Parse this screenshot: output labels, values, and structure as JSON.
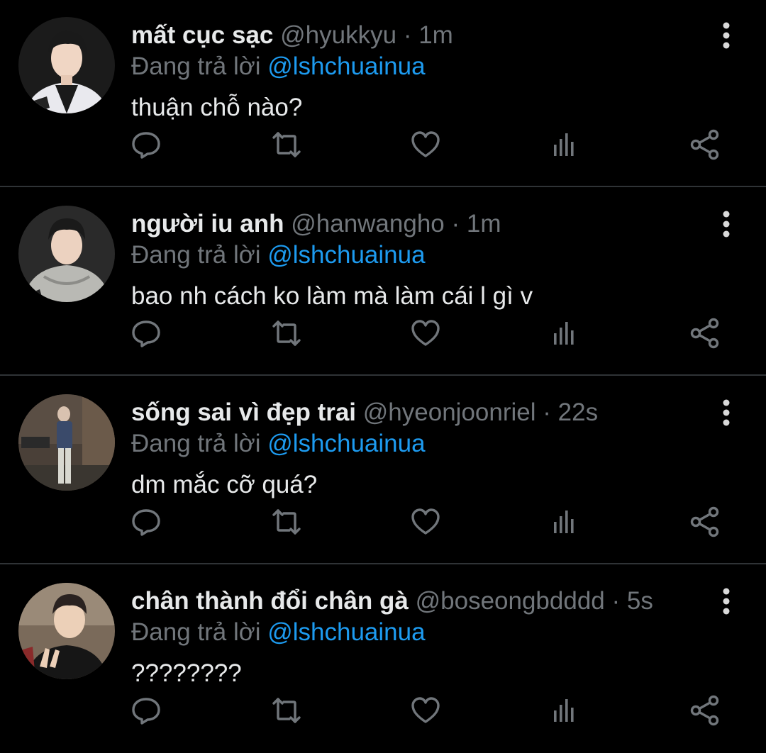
{
  "reply_prefix": "Đang trả lời",
  "colors": {
    "background": "#000000",
    "name": "#e7e9ea",
    "secondary": "#71767b",
    "mention": "#1d9bf0",
    "divider": "#2f3336"
  },
  "action_icons": [
    "reply-icon",
    "retweet-icon",
    "like-icon",
    "views-icon",
    "share-icon"
  ],
  "tweets": [
    {
      "name": "mất cục sạc",
      "handle": "@hyukkyu",
      "separator": "·",
      "time": "1m",
      "mention": "@lshchuainua",
      "text": "thuận chỗ nào?"
    },
    {
      "name": "người iu anh",
      "handle": "@hanwangho",
      "separator": "·",
      "time": "1m",
      "mention": "@lshchuainua",
      "text": "bao nh cách ko làm mà làm cái l gì v"
    },
    {
      "name": "sống sai vì đẹp trai",
      "handle": "@hyeonjoonriel",
      "separator": "·",
      "time": "22s",
      "mention": "@lshchuainua",
      "text": "dm mắc cỡ quá?"
    },
    {
      "name": "chân thành đổi chân gà",
      "handle": "@boseongbdddd",
      "separator": "·",
      "time": "5s",
      "mention": "@lshchuainua",
      "text": "????????"
    }
  ]
}
